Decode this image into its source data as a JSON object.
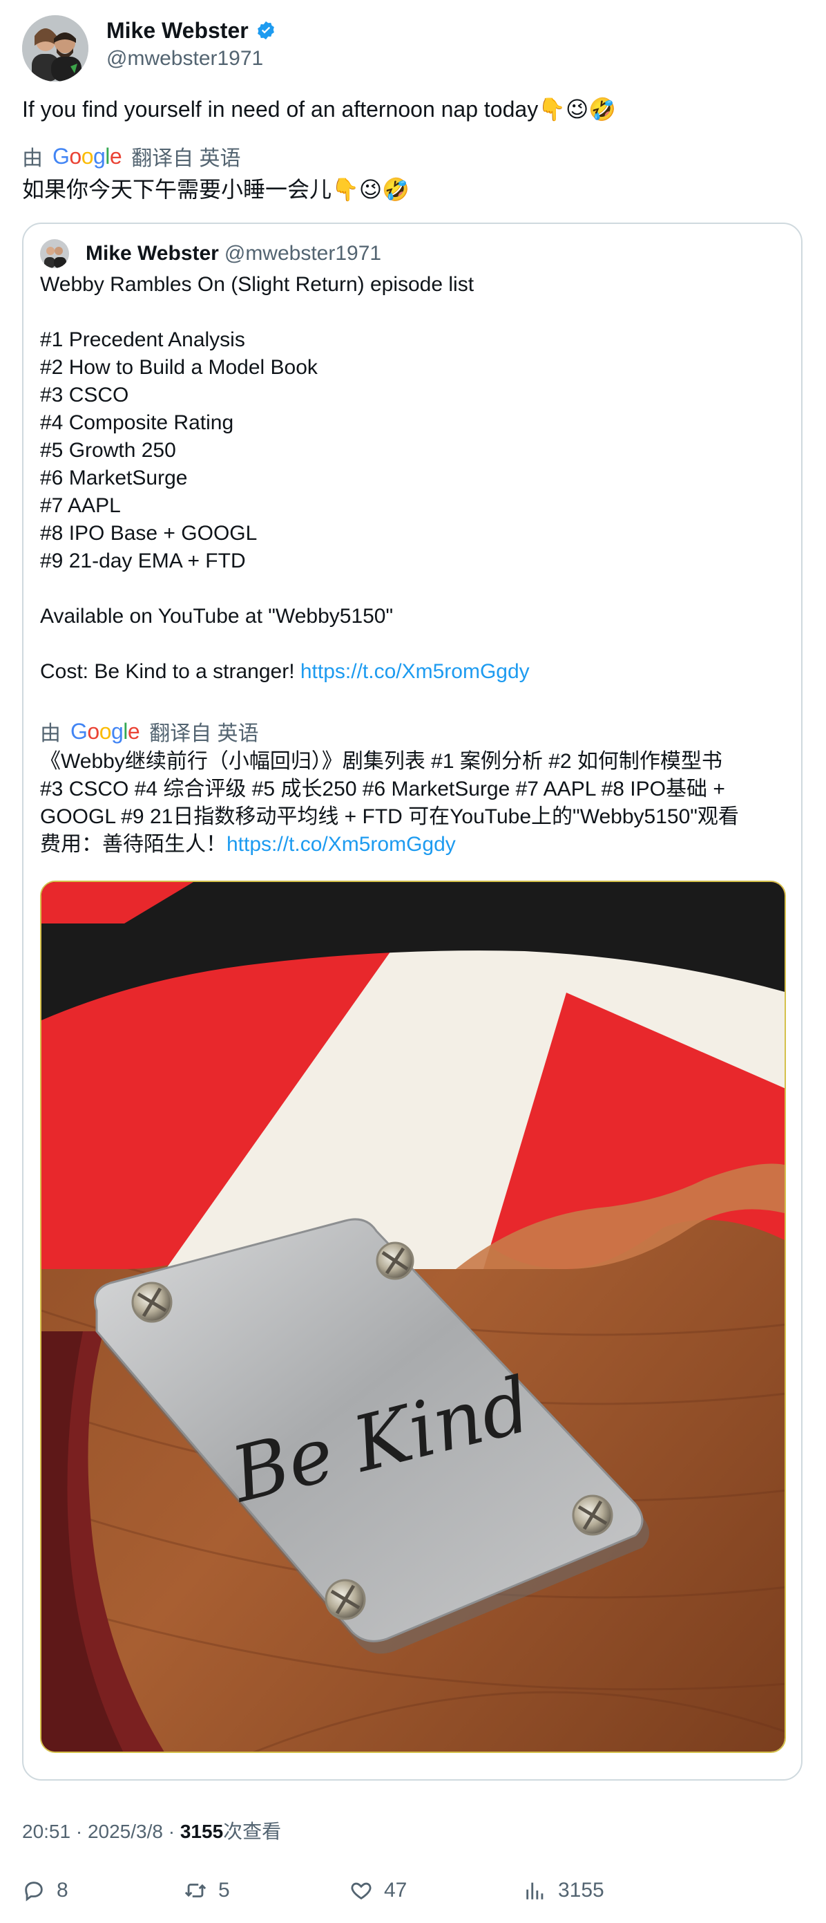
{
  "author": {
    "name": "Mike Webster",
    "handle": "@mwebster1971"
  },
  "tweet": {
    "text": "If you find yourself in need of an afternoon nap today👇😉🤣",
    "translation_prefix": "由",
    "translation_suffix": "翻译自 英语",
    "google_logo": "Google",
    "translated_text": "如果你今天下午需要小睡一会儿👇😉🤣"
  },
  "quote": {
    "name": "Mike Webster",
    "handle": "@mwebster1971",
    "title": "Webby Rambles On (Slight Return) episode list",
    "episodes": [
      "#1 Precedent Analysis",
      "#2 How to Build a Model Book",
      "#3 CSCO",
      "#4 Composite Rating",
      "#5 Growth 250",
      "#6 MarketSurge",
      "#7 AAPL",
      "#8 IPO Base + GOOGL",
      "#9 21-day EMA + FTD"
    ],
    "available": "Available on YouTube at \"Webby5150\"",
    "cost_text": "Cost: Be Kind to a stranger!",
    "link": "https://t.co/Xm5romGgdy",
    "translation_prefix": "由",
    "translation_suffix": "翻译自 英语",
    "google_logo": "Google",
    "translated_line1": "《Webby继续前行（小幅回归）》剧集列表 #1 案例分析 #2 如何制作模型书",
    "translated_line2": "#3 CSCO #4 综合评级 #5 成长250 #6 MarketSurge #7 AAPL #8 IPO基础 +",
    "translated_line3": "GOOGL #9 21日指数移动平均线 + FTD 可在YouTube上的\"Webby5150\"观看",
    "translated_line4": "费用：善待陌生人！",
    "translated_link": "https://t.co/Xm5romGgdy",
    "image_engraving": "Be Kind"
  },
  "meta": {
    "time": "20:51",
    "date": "2025/3/8",
    "views_count": "3155",
    "views_label": "次查看",
    "separator": "·"
  },
  "actions": {
    "replies": "8",
    "retweets": "5",
    "likes": "47",
    "views": "3155"
  },
  "colors": {
    "link": "#1d9bf0",
    "secondary_text": "#536471",
    "verified": "#1d9bf0"
  }
}
